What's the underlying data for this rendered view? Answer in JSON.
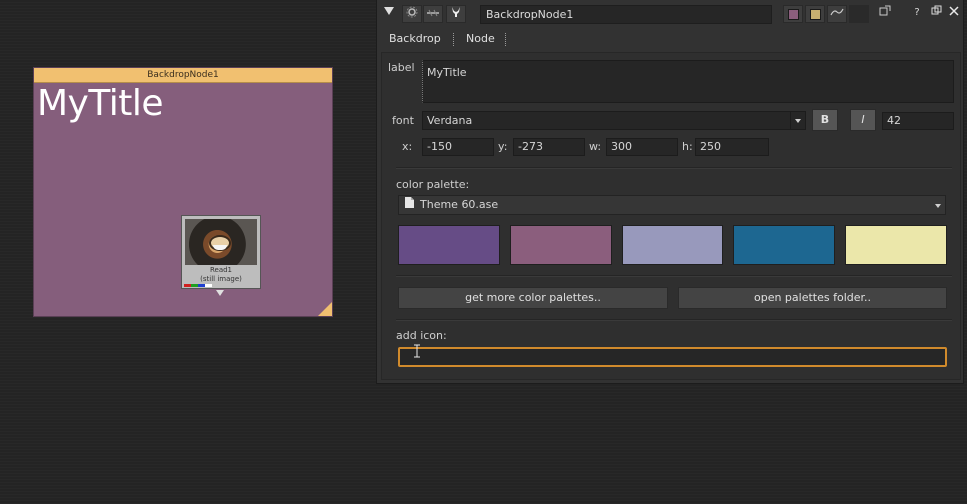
{
  "backdrop": {
    "title": "BackdropNode1",
    "label": "MyTitle",
    "color": "#855e7c",
    "header_color": "#f1c070"
  },
  "read_node": {
    "name": "Read1",
    "subtitle": "(still image)"
  },
  "panel": {
    "node_name": "BackdropNode1",
    "icons": [
      "collapse-arrow-icon",
      "settings-icon",
      "link-icon",
      "horns-icon",
      "color-swatch-icon",
      "color-swatch2-icon",
      "curve-icon",
      "blank-icon",
      "undock-icon",
      "help-icon",
      "float-icon",
      "close-icon"
    ],
    "help_label": "?",
    "tabs": [
      "Backdrop",
      "Node"
    ],
    "label_field": {
      "name": "label",
      "value": "MyTitle"
    },
    "font": {
      "name": "font",
      "value": "Verdana",
      "bold_label": "B",
      "italic_label": "I",
      "size": "42"
    },
    "coords": {
      "x_label": "x:",
      "x": "-150",
      "y_label": "y:",
      "y": "-273",
      "w_label": "w:",
      "w": "300",
      "h_label": "h:",
      "h": "250"
    },
    "color_palette": {
      "label": "color palette:",
      "selected": "Theme 60.ase",
      "swatches": [
        "#664c86",
        "#8b5e7d",
        "#9899bc",
        "#1d6791",
        "#ebe7aa"
      ]
    },
    "buttons": {
      "get_more": "get more color palettes..",
      "open_folder": "open palettes folder.."
    },
    "add_icon": {
      "label": "add icon:",
      "value": ""
    }
  }
}
